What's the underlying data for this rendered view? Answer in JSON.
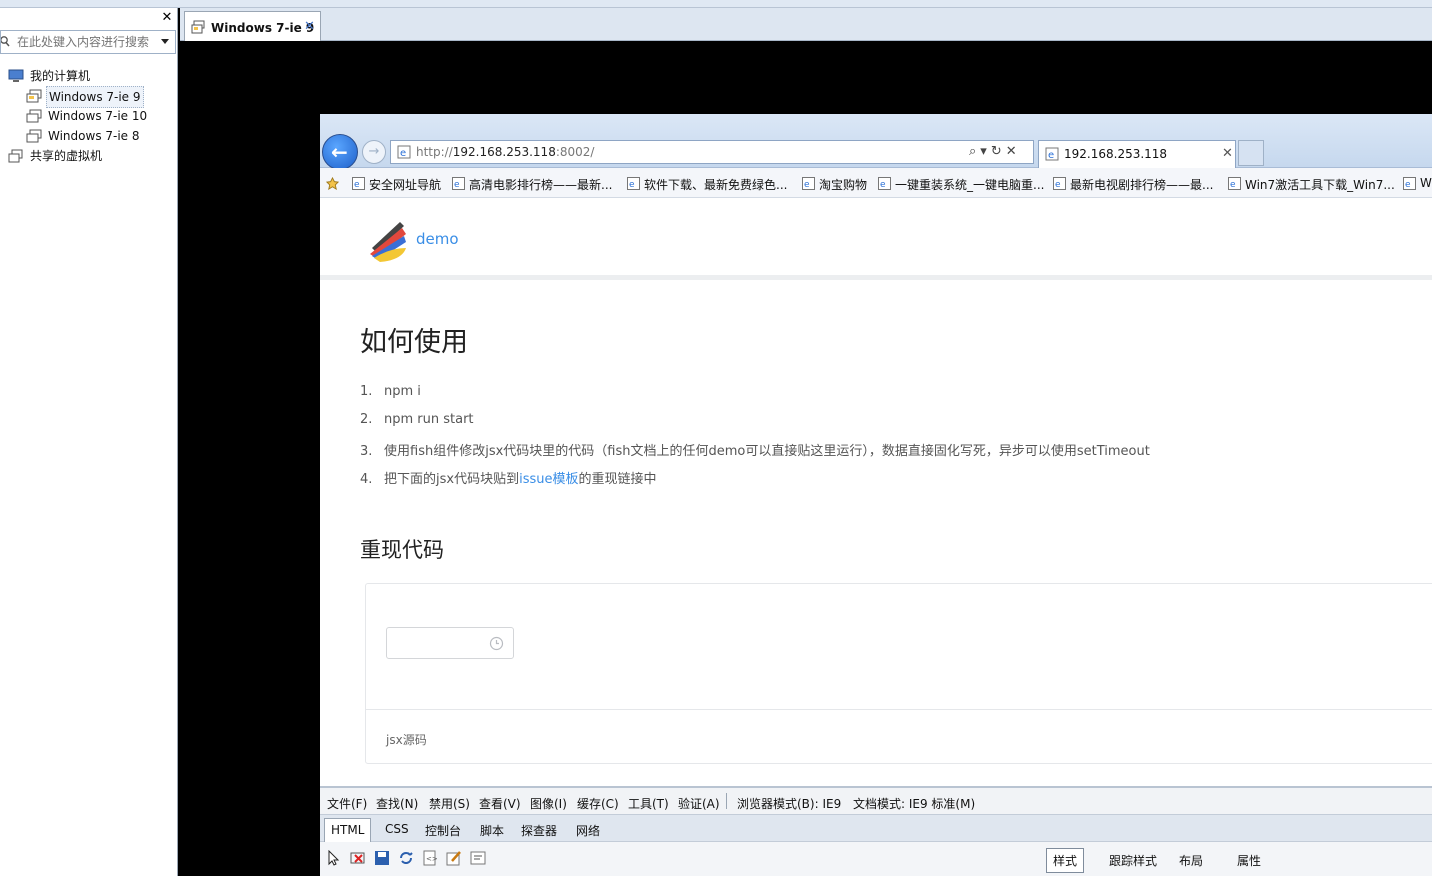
{
  "left_panel": {
    "search_placeholder": "在此处键入内容进行搜索",
    "tree": [
      {
        "label": "我的计算机",
        "icon": "computer-icon"
      },
      {
        "label": "Windows 7-ie 9",
        "icon": "vm-icon",
        "selected": true
      },
      {
        "label": "Windows 7-ie 10",
        "icon": "vm-icon"
      },
      {
        "label": "Windows 7-ie 8",
        "icon": "vm-icon"
      },
      {
        "label": "共享的虚拟机",
        "icon": "shared-vm-icon"
      }
    ]
  },
  "vm_tab": {
    "label": "Windows 7-ie 9"
  },
  "ie": {
    "url_prefix": "http://",
    "url_host": "192.168.253.118",
    "url_suffix": ":8002/",
    "tab_label": "192.168.253.118",
    "favorites": [
      "安全网址导航",
      "高清电影排行榜——最新...",
      "软件下载、最新免费绿色...",
      "淘宝购物",
      "一键重装系统_一键电脑重...",
      "最新电视剧排行榜——最...",
      "Win7激活工具下载_Win7...",
      "W"
    ]
  },
  "page": {
    "site_name": "demo",
    "h1": "如何使用",
    "steps": [
      {
        "num": "1.",
        "text": "npm i"
      },
      {
        "num": "2.",
        "text": "npm run start"
      },
      {
        "num": "3.",
        "text": "使用fish组件修改jsx代码块里的代码（fish文档上的任何demo可以直接贴这里运行），数据直接固化写死，异步可以使用setTimeout"
      },
      {
        "num": "4.",
        "pre": "把下面的jsx代码块贴到",
        "link": "issue模板",
        "post": "的重现链接中"
      }
    ],
    "h2": "重现代码",
    "jsx_source": "jsx源码"
  },
  "devtools": {
    "menu": [
      "文件(F)",
      "查找(N)",
      "禁用(S)",
      "查看(V)",
      "图像(I)",
      "缓存(C)",
      "工具(T)",
      "验证(A)"
    ],
    "browser_mode": "浏览器模式(B):  IE9",
    "doc_mode": "文档模式:  IE9 标准(M)",
    "tabs": [
      "HTML",
      "CSS",
      "控制台",
      "脚本",
      "探查器",
      "网络"
    ],
    "right_tabs": [
      "样式",
      "跟踪样式",
      "布局",
      "属性"
    ]
  }
}
